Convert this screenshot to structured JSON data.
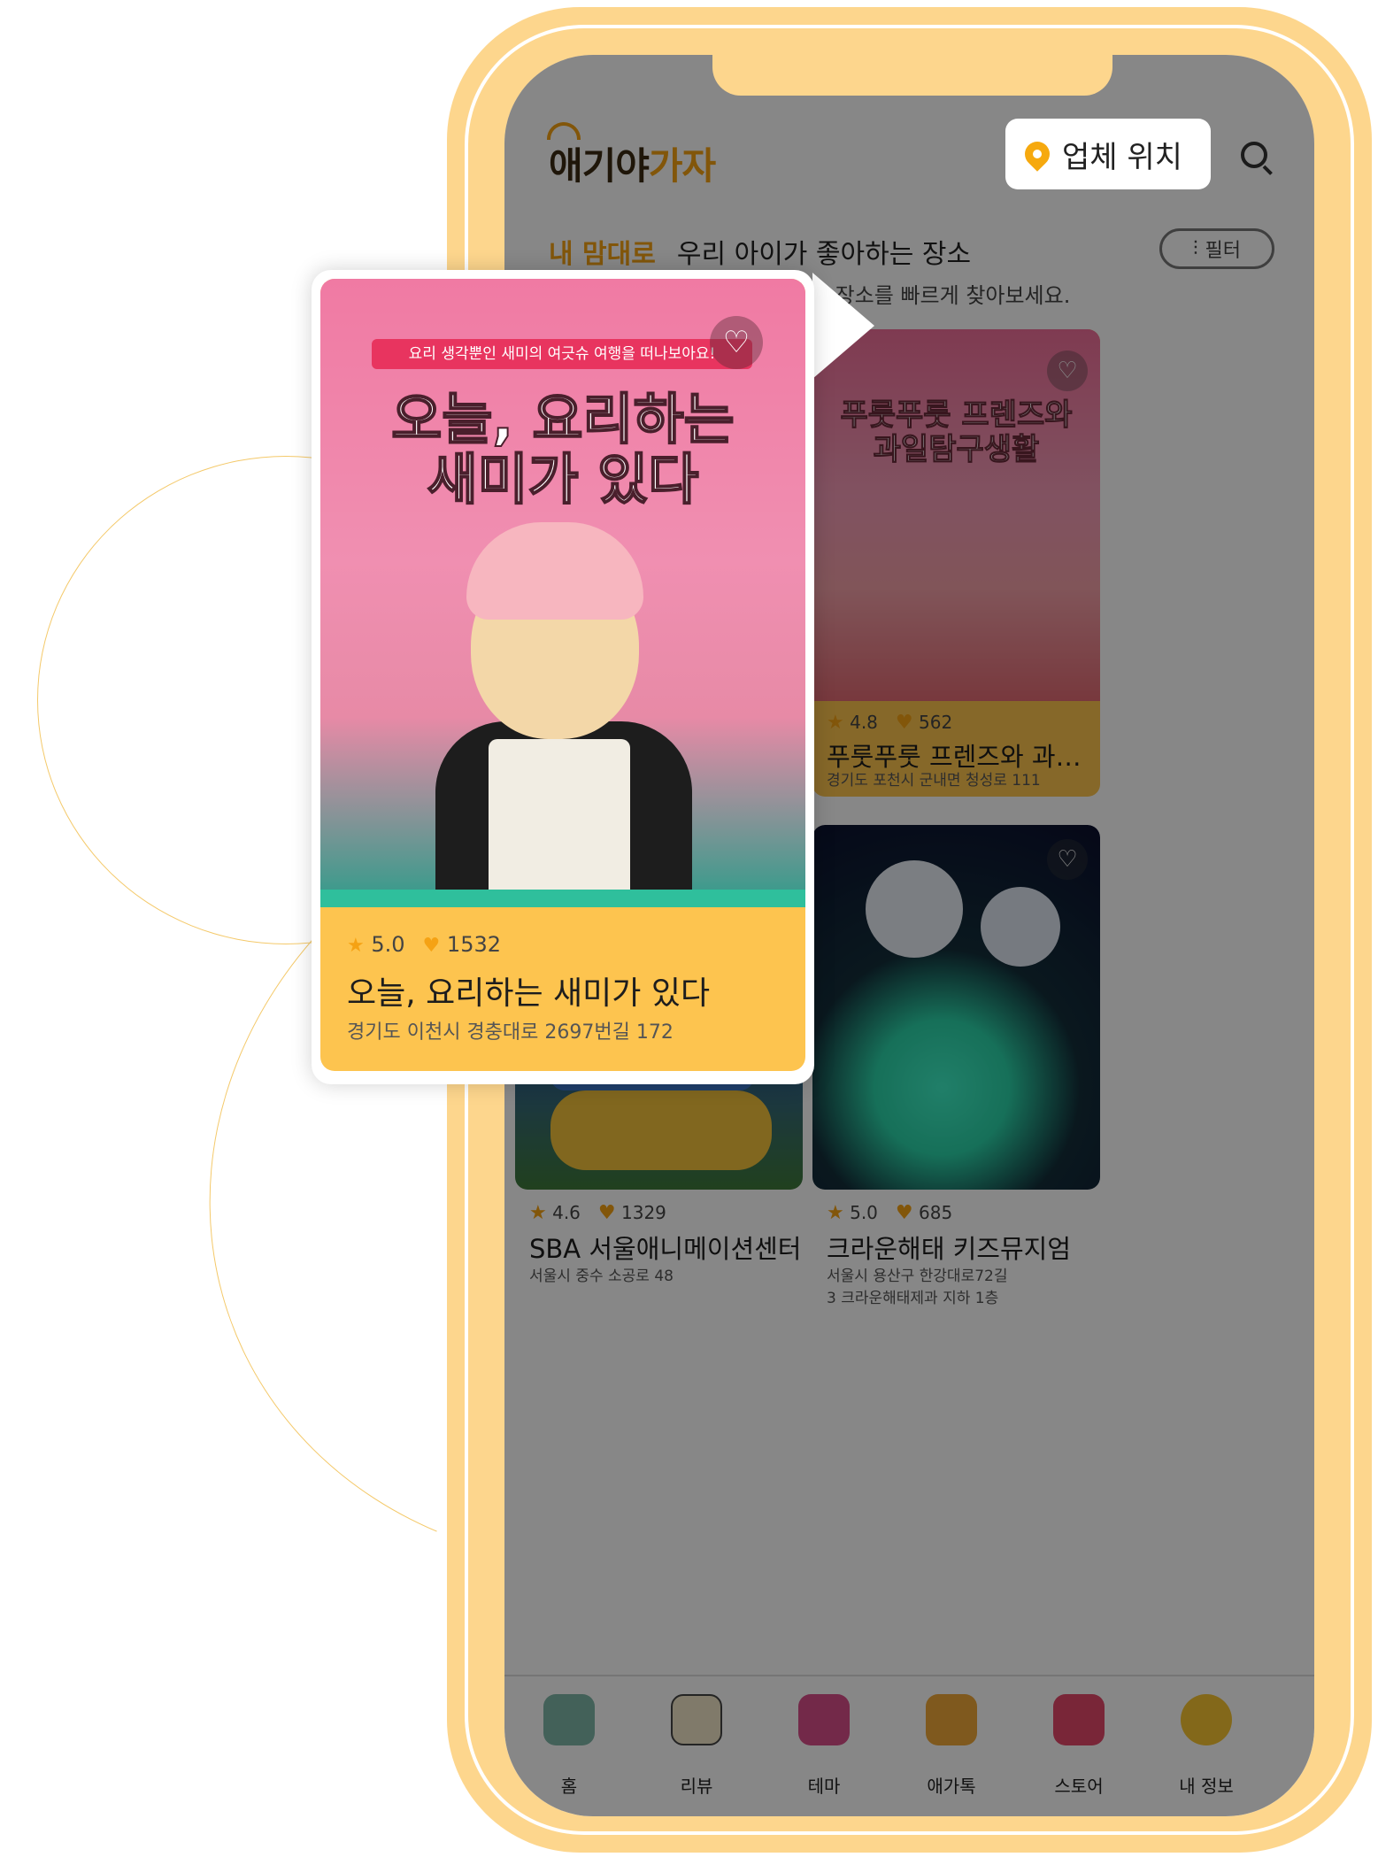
{
  "header": {
    "logo_part1": "애기야",
    "logo_part2": "가자",
    "location_button": "업체 위치"
  },
  "section": {
    "highlight": "내 맘대로",
    "title": "우리 아이가 좋아하는 장소",
    "filter_label": "필터",
    "subtitle": "해 원하는 장소를 빠르게 찾아보세요."
  },
  "featured": {
    "ribbon": "요리 생각뿐인 새미의 여긋슈 여행을 떠나보아요!",
    "image_title_line1": "오늘, 요리하는",
    "image_title_line2": "새미가 있다",
    "rating": "5.0",
    "likes": "1532",
    "title": "오늘, 요리하는 새미가 있다",
    "address": "경기도 이천시 경충대로 2697번길 172"
  },
  "cards": [
    {
      "image_title_line1": "푸룻푸룻 프렌즈와",
      "image_title_line2": "과일탐구생활",
      "rating": "4.8",
      "likes": "562",
      "title": "푸룻푸룻 프렌즈와 과일탐구...",
      "address": "경기도 포천시 군내면 청성로 111"
    },
    {
      "rating": "4.6",
      "likes": "1329",
      "title": "SBA 서울애니메이션센터",
      "address": "서울시 중수 소공로 48"
    },
    {
      "rating": "5.0",
      "likes": "685",
      "title": "크라운해태 키즈뮤지엄",
      "address": "서울시 용산구 한강대로72길 3 크라운해태제과 지하 1층"
    }
  ],
  "nav": [
    {
      "label": "홈",
      "icon": "house-icon",
      "color": "#7fb8a8"
    },
    {
      "label": "리뷰",
      "icon": "notepad-icon",
      "color": "#f2e7c8"
    },
    {
      "label": "테마",
      "icon": "gift-icon",
      "color": "#d94e8a"
    },
    {
      "label": "애가톡",
      "icon": "chat-icon",
      "color": "#f0a93a"
    },
    {
      "label": "스토어",
      "icon": "store-icon",
      "color": "#e5486b"
    },
    {
      "label": "내 정보",
      "icon": "smiley-icon",
      "color": "#f7c531"
    }
  ],
  "colors": {
    "accent": "#f5a214",
    "frame": "#fdd68d",
    "card": "#fdc44f"
  }
}
